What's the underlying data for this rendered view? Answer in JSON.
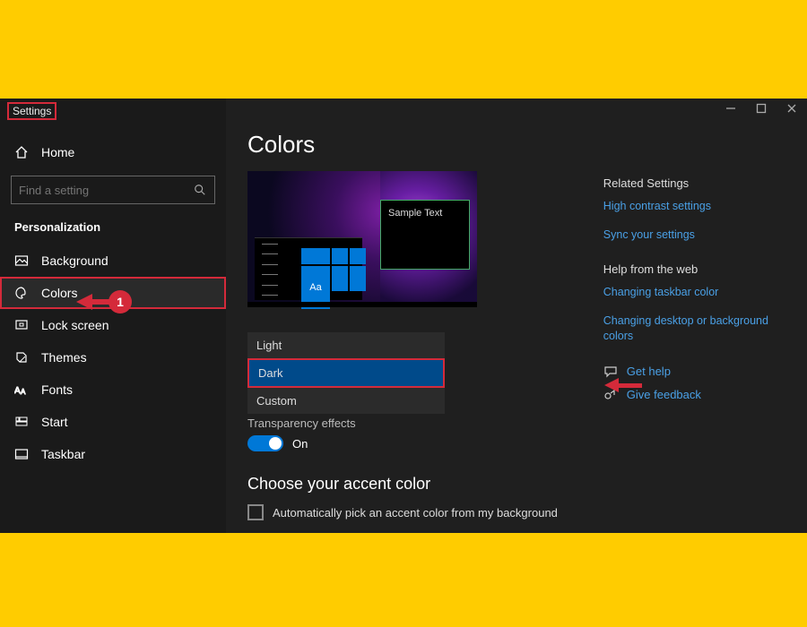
{
  "app_title": "Settings",
  "sidebar": {
    "home": "Home",
    "search_placeholder": "Find a setting",
    "category": "Personalization",
    "items": [
      {
        "label": "Background"
      },
      {
        "label": "Colors"
      },
      {
        "label": "Lock screen"
      },
      {
        "label": "Themes"
      },
      {
        "label": "Fonts"
      },
      {
        "label": "Start"
      },
      {
        "label": "Taskbar"
      }
    ]
  },
  "main": {
    "page_title": "Colors",
    "preview": {
      "sample_text": "Sample Text",
      "tile_text": "Aa"
    },
    "mode_options": {
      "light": "Light",
      "dark": "Dark",
      "custom": "Custom"
    },
    "transparency_label": "Transparency effects",
    "transparency_state": "On",
    "accent_heading": "Choose your accent color",
    "auto_accent_label": "Automatically pick an accent color from my background"
  },
  "right": {
    "related_heading": "Related Settings",
    "links": [
      "High contrast settings",
      "Sync your settings"
    ],
    "help_heading": "Help from the web",
    "help_links": [
      "Changing taskbar color",
      "Changing desktop or background colors"
    ],
    "get_help": "Get help",
    "give_feedback": "Give feedback"
  },
  "annotation": {
    "step1": "1"
  }
}
